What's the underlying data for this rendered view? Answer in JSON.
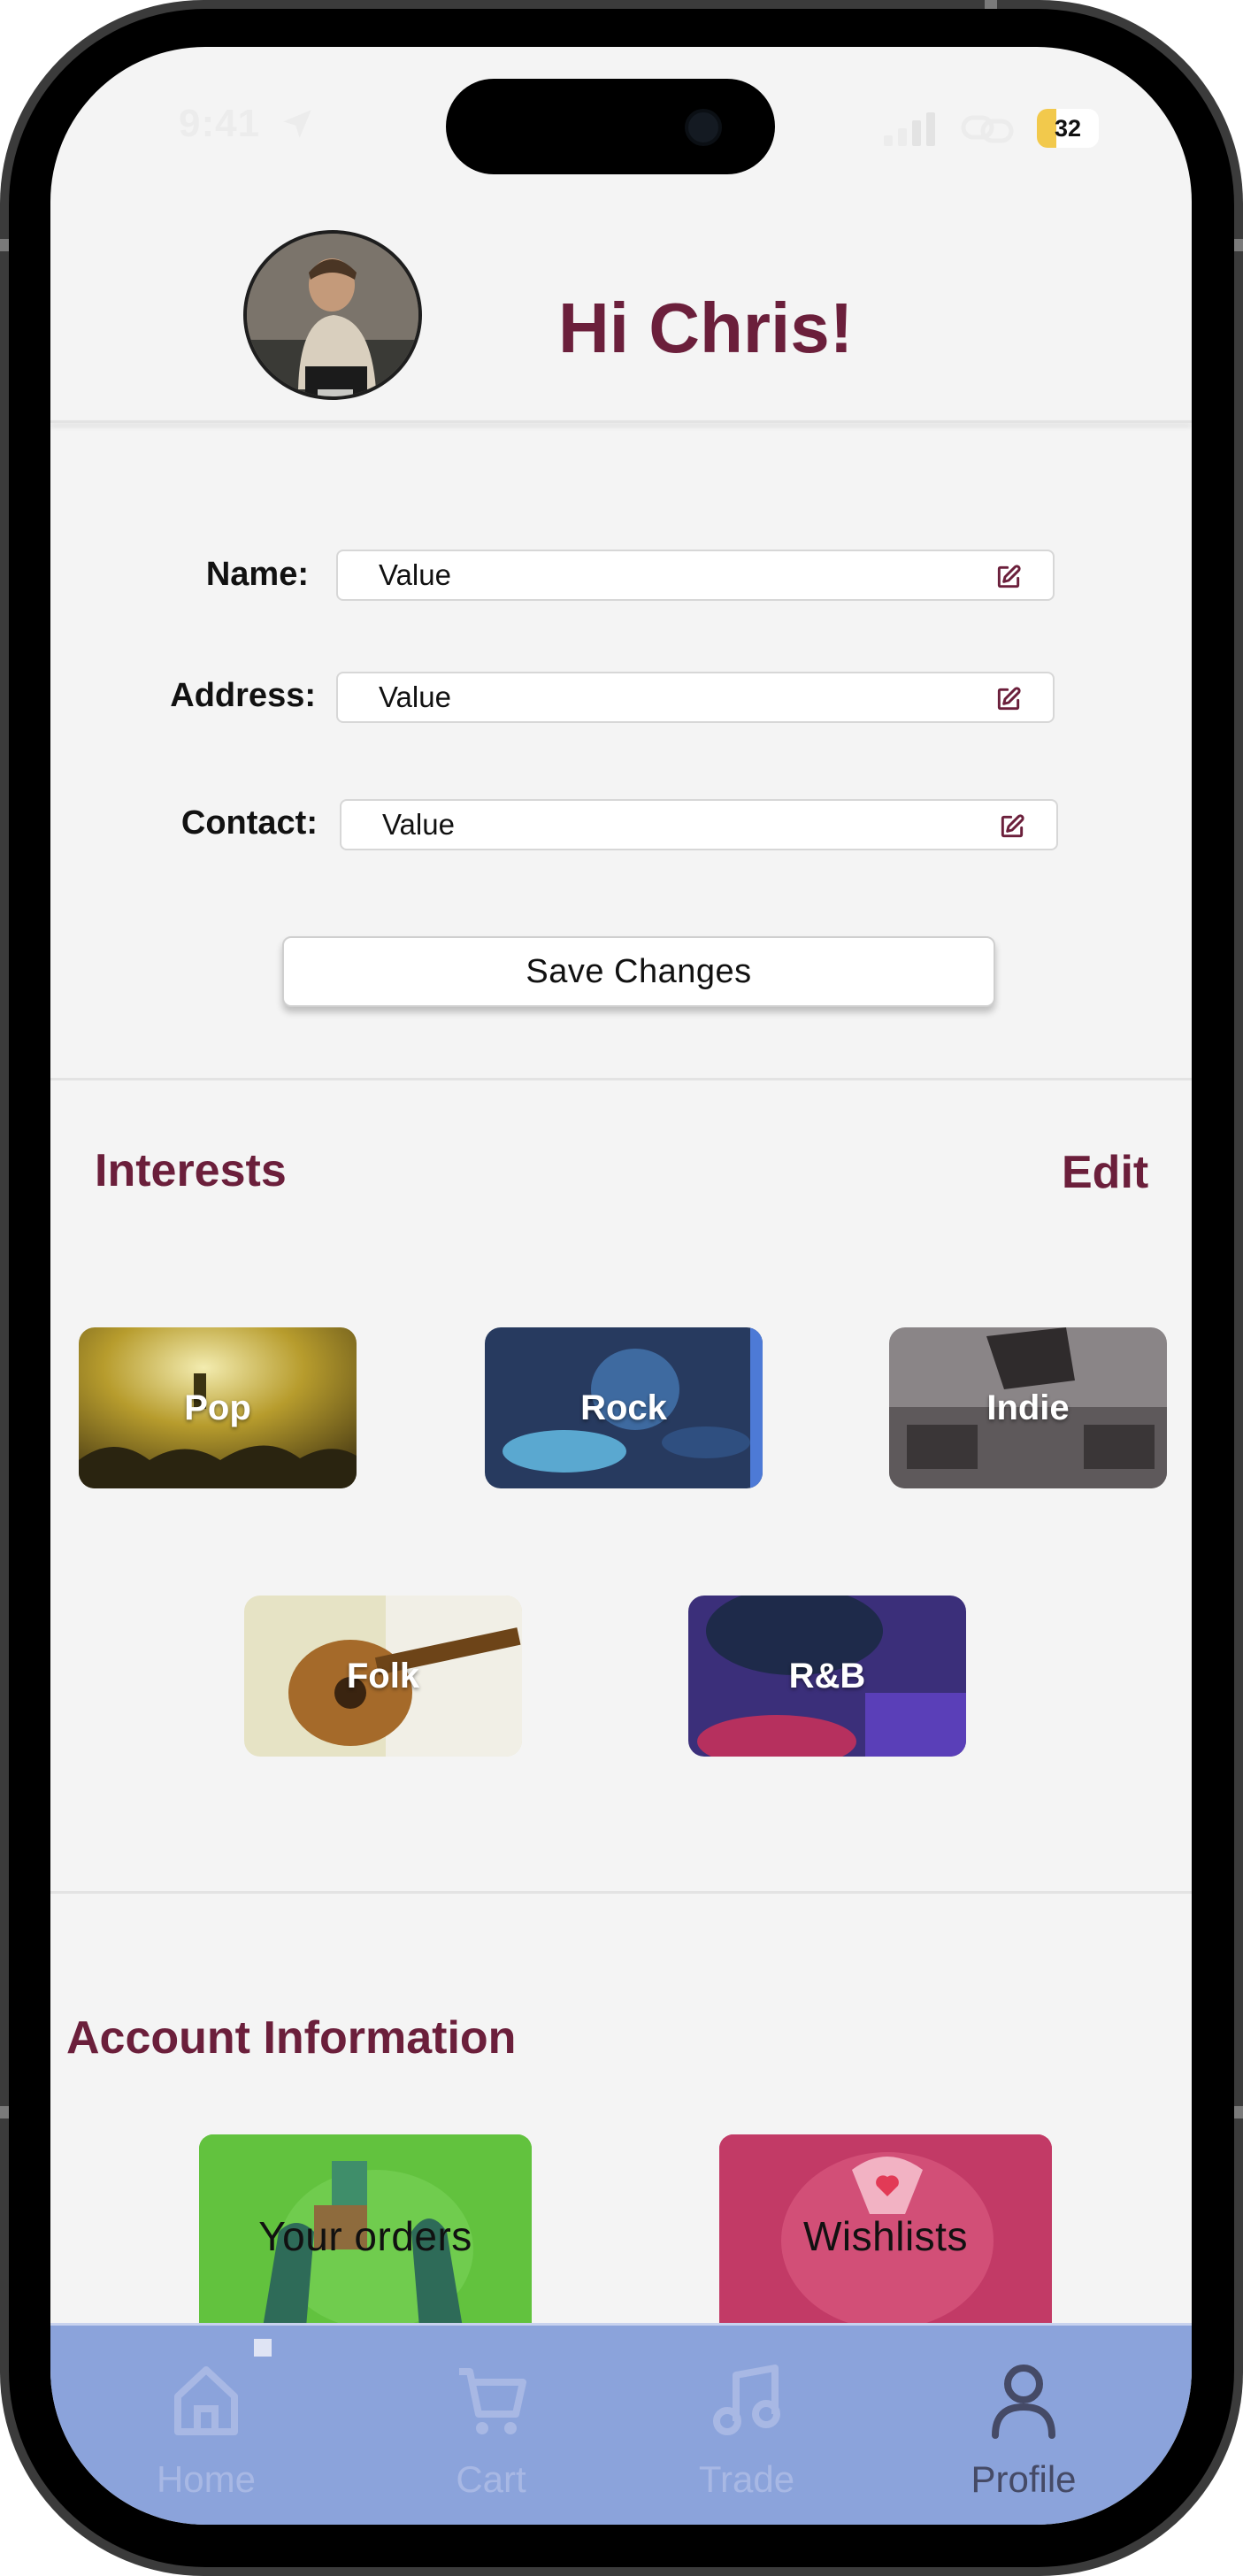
{
  "status_bar": {
    "time": "9:41",
    "battery_level": 32,
    "battery_text": "32",
    "icons": [
      "location-arrow-icon",
      "signal-icon",
      "link-icon",
      "battery-icon"
    ]
  },
  "header": {
    "greeting": "Hi Chris!"
  },
  "profile_form": {
    "fields": [
      {
        "label": "Name:",
        "value": "Value"
      },
      {
        "label": "Address:",
        "value": "Value"
      },
      {
        "label": "Contact:",
        "value": "Value"
      }
    ],
    "save_label": "Save Changes"
  },
  "interests": {
    "title": "Interests",
    "edit_label": "Edit",
    "items": [
      {
        "label": "Pop"
      },
      {
        "label": "Rock"
      },
      {
        "label": "Indie"
      },
      {
        "label": "Folk"
      },
      {
        "label": "R&B"
      }
    ]
  },
  "account": {
    "title": "Account Information",
    "tiles": [
      {
        "label": "Your orders",
        "color": "#62c23e"
      },
      {
        "label": "Wishlists",
        "color": "#c23a66"
      }
    ]
  },
  "tab_bar": {
    "items": [
      {
        "label": "Home",
        "icon": "home-icon",
        "active": false
      },
      {
        "label": "Cart",
        "icon": "cart-icon",
        "active": false
      },
      {
        "label": "Trade",
        "icon": "music-note-icon",
        "active": false
      },
      {
        "label": "Profile",
        "icon": "person-icon",
        "active": true
      }
    ]
  },
  "colors": {
    "accent": "#6b1f3b",
    "tab_bar": "#8ba3db",
    "screen_bg": "#f4f4f4"
  }
}
